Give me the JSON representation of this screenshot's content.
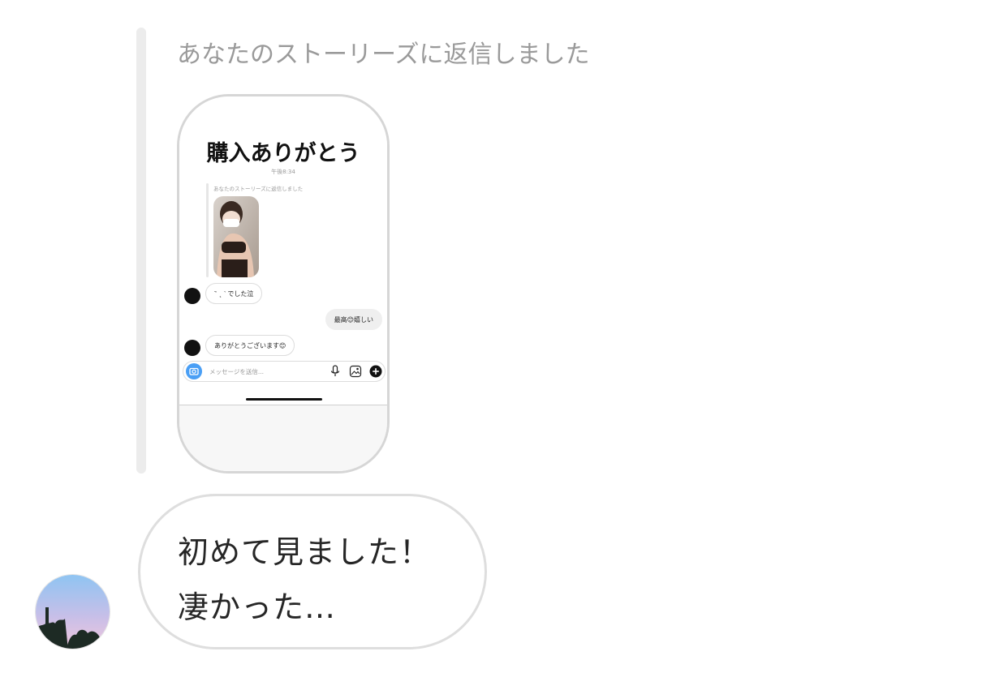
{
  "reply": {
    "header": "あなたのストーリーズに返信しました"
  },
  "story": {
    "title": "購入ありがとう",
    "time": "午後8:34",
    "mini_reply_header": "あなたのストーリーズに返信しました",
    "messages": [
      {
        "side": "received",
        "text": "‶ ˛ ‵ でした泣"
      },
      {
        "side": "sent",
        "text": "最高😊嬉しい"
      },
      {
        "side": "received",
        "text": "ありがとうございます😊"
      }
    ],
    "input_placeholder": "メッセージを送信..."
  },
  "message": {
    "lines": [
      "初めて見ました！",
      "凄かった…"
    ]
  },
  "icons": {
    "camera": "camera-icon",
    "mic": "microphone-icon",
    "gallery": "gallery-icon",
    "plus": "plus-icon"
  },
  "colors": {
    "bubble_border": "#dedede",
    "reply_bar": "#ececec",
    "muted_text": "#9a9a9a",
    "camera_blue": "#4a9ff5"
  }
}
